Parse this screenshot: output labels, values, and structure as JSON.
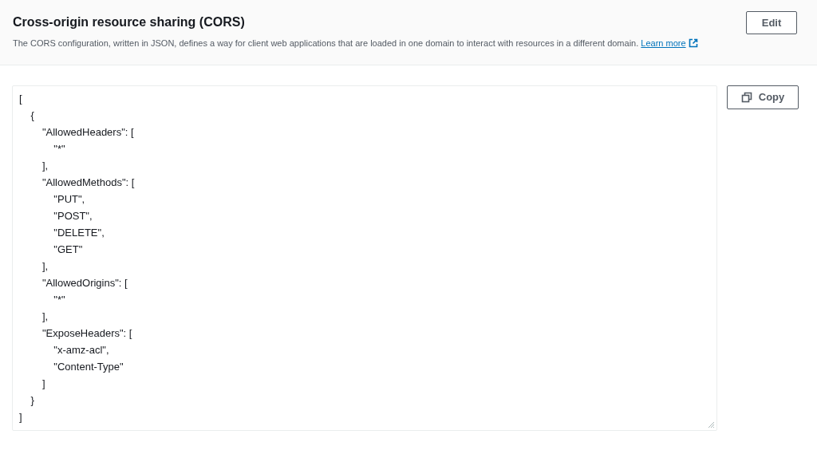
{
  "header": {
    "title": "Cross-origin resource sharing (CORS)",
    "description": "The CORS configuration, written in JSON, defines a way for client web applications that are loaded in one domain to interact with resources in a different domain.",
    "learn_more": "Learn more",
    "edit_button": "Edit"
  },
  "editor": {
    "code": "[\n    {\n        \"AllowedHeaders\": [\n            \"*\"\n        ],\n        \"AllowedMethods\": [\n            \"PUT\",\n            \"POST\",\n            \"DELETE\",\n            \"GET\"\n        ],\n        \"AllowedOrigins\": [\n            \"*\"\n        ],\n        \"ExposeHeaders\": [\n            \"x-amz-acl\",\n            \"Content-Type\"\n        ]\n    }\n]"
  },
  "copy_button": "Copy"
}
